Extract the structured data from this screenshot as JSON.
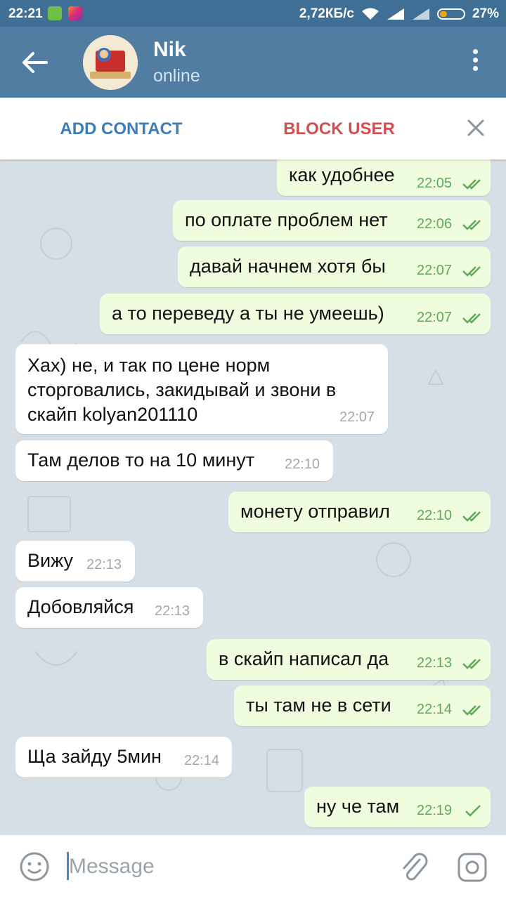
{
  "status_bar": {
    "time": "22:21",
    "speed": "2,72КБ/с",
    "battery": "27%",
    "battery_level": 0.27
  },
  "header": {
    "contact_name": "Nik",
    "contact_status": "online",
    "icons": [
      "back-arrow-icon",
      "avatar",
      "more-vert-icon"
    ]
  },
  "action_bar": {
    "add_contact": "ADD CONTACT",
    "block_user": "BLOCK USER"
  },
  "messages": [
    {
      "dir": "out",
      "text": "как удобнее",
      "time": "22:05",
      "status": "read"
    },
    {
      "dir": "out",
      "text": "по оплате проблем нет",
      "time": "22:06",
      "status": "read"
    },
    {
      "dir": "out",
      "text": "давай начнем хотя бы",
      "time": "22:07",
      "status": "read"
    },
    {
      "dir": "out",
      "text": "а то переведу а ты не умеешь)",
      "time": "22:07",
      "status": "read"
    },
    {
      "dir": "in",
      "lines": [
        "Хах) не, и так по цене норм",
        "сторговались, закидывай и звони в",
        "скайп kolyan201110"
      ],
      "time": "22:07"
    },
    {
      "dir": "in",
      "text": "Там делов то на 10 минут",
      "time": "22:10"
    },
    {
      "dir": "out",
      "text": "монету отправил",
      "time": "22:10",
      "status": "read"
    },
    {
      "dir": "in",
      "text": "Вижу",
      "time": "22:13"
    },
    {
      "dir": "in",
      "text": "Добовляйся",
      "time": "22:13"
    },
    {
      "dir": "out",
      "text": "в скайп написал да",
      "time": "22:13",
      "status": "read"
    },
    {
      "dir": "out",
      "text": "ты там не в сети",
      "time": "22:14",
      "status": "read"
    },
    {
      "dir": "in",
      "text": "Ща зайду 5мин",
      "time": "22:14"
    },
    {
      "dir": "out",
      "text": "ну че там",
      "time": "22:19",
      "status": "sent"
    }
  ],
  "input": {
    "placeholder": "Message"
  },
  "colors": {
    "header": "#527da3",
    "status_bar": "#3f6f95",
    "outgoing_bubble": "#effdde",
    "incoming_bubble": "#ffffff",
    "check": "#5fa85a",
    "add_contact": "#3f7bb5",
    "block_user": "#cf5050"
  }
}
